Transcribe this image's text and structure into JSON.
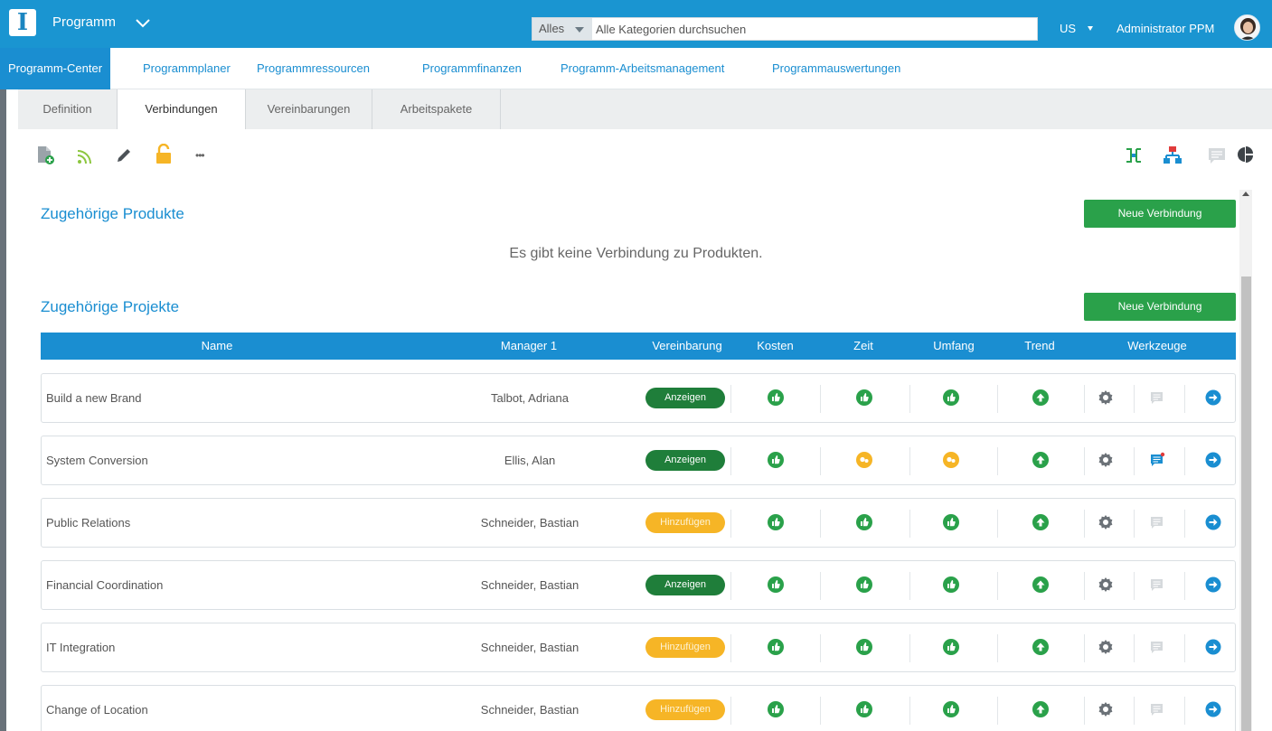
{
  "header": {
    "logo": "I",
    "app_title": "Programm",
    "search_scope": "Alles",
    "search_placeholder": "Alle Kategorien durchsuchen",
    "locale": "US",
    "user_name": "Administrator PPM"
  },
  "nav": {
    "items": [
      {
        "label": "Programm-Center",
        "active": true
      },
      {
        "label": "Programmplaner"
      },
      {
        "label": "Programmressourcen"
      },
      {
        "label": "Programmfinanzen"
      },
      {
        "label": "Programm-Arbeitsmanagement"
      },
      {
        "label": "Programmauswertungen"
      }
    ]
  },
  "tabs": [
    {
      "label": "Definition"
    },
    {
      "label": "Verbindungen",
      "active": true
    },
    {
      "label": "Vereinbarungen"
    },
    {
      "label": "Arbeitspakete"
    }
  ],
  "toolbar": {
    "more_label": "•••"
  },
  "products": {
    "title": "Zugehörige Produkte",
    "button": "Neue Verbindung",
    "empty_message": "Es gibt keine Verbindung zu Produkten."
  },
  "projects": {
    "title": "Zugehörige Projekte",
    "button": "Neue Verbindung",
    "columns": [
      "Name",
      "Manager 1",
      "Vereinbarung",
      "Kosten",
      "Zeit",
      "Umfang",
      "Trend",
      "Werkzeuge"
    ],
    "rows": [
      {
        "name": "Build a new Brand",
        "manager": "Talbot, Adriana",
        "agreement": "Anzeigen",
        "agreement_status": "green",
        "cost": "good",
        "time": "good",
        "scope": "good",
        "trend": "up",
        "has_comment": false
      },
      {
        "name": "System Conversion",
        "manager": "Ellis, Alan",
        "agreement": "Anzeigen",
        "agreement_status": "green",
        "cost": "good",
        "time": "warning",
        "scope": "warning",
        "trend": "up",
        "has_comment": true
      },
      {
        "name": "Public Relations",
        "manager": "Schneider, Bastian",
        "agreement": "Hinzufügen",
        "agreement_status": "orange",
        "cost": "good",
        "time": "good",
        "scope": "good",
        "trend": "up",
        "has_comment": false
      },
      {
        "name": "Financial Coordination",
        "manager": "Schneider, Bastian",
        "agreement": "Anzeigen",
        "agreement_status": "green",
        "cost": "good",
        "time": "good",
        "scope": "good",
        "trend": "up",
        "has_comment": false
      },
      {
        "name": "IT Integration",
        "manager": "Schneider, Bastian",
        "agreement": "Hinzufügen",
        "agreement_status": "orange",
        "cost": "good",
        "time": "good",
        "scope": "good",
        "trend": "up",
        "has_comment": false
      },
      {
        "name": "Change of Location",
        "manager": "Schneider, Bastian",
        "agreement": "Hinzufügen",
        "agreement_status": "orange",
        "cost": "good",
        "time": "good",
        "scope": "good",
        "trend": "up",
        "has_comment": false
      }
    ]
  },
  "colors": {
    "brand": "#1a95d1",
    "good": "#2aa14a",
    "warning": "#f6b526",
    "link_blue": "#1a8ed1"
  }
}
